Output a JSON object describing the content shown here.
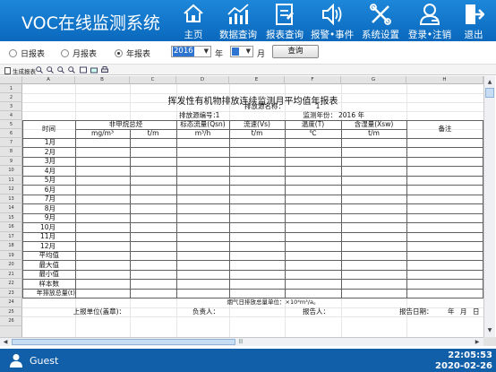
{
  "app": {
    "title": "VOC在线监测系统"
  },
  "nav": [
    {
      "label": "主页",
      "icon": "home-icon"
    },
    {
      "label": "数据查询",
      "icon": "chart-icon"
    },
    {
      "label": "报表查询",
      "icon": "report-icon"
    },
    {
      "label": "报警•事件",
      "icon": "speaker-icon"
    },
    {
      "label": "系统设置",
      "icon": "tools-icon"
    },
    {
      "label": "登录•注销",
      "icon": "user-icon"
    },
    {
      "label": "退出",
      "icon": "exit-icon"
    }
  ],
  "filter": {
    "daily": "日报表",
    "monthly": "月报表",
    "yearly": "年报表",
    "selected": "年报表",
    "year_value": "2016",
    "year_unit": "年",
    "month_value": "",
    "month_unit": "月",
    "query_label": "查询"
  },
  "report_toolbar": {
    "generate_label": "生成报表",
    "icons": [
      "zoom-in-icon",
      "zoom-out-icon",
      "zoom-out-icon",
      "zoom-fit-icon",
      "view-icon",
      "export-icon",
      "print-icon"
    ]
  },
  "sheet": {
    "columns": [
      "A",
      "B",
      "C",
      "D",
      "E",
      "F",
      "G",
      "H"
    ],
    "rows": [
      "1",
      "2",
      "3",
      "4",
      "5",
      "6",
      "7",
      "8",
      "9",
      "10",
      "11",
      "12",
      "13",
      "14",
      "15",
      "16",
      "17",
      "18",
      "19",
      "20",
      "21",
      "22",
      "23",
      "24",
      "25",
      "26"
    ],
    "title": "挥发性有机物排放连续监测月平均值年报表",
    "source_name_label": "排放源名称：",
    "source_name_value": "1",
    "source_no_label": "排放源编号：",
    "source_no_value": "1",
    "year_label": "监测年份：",
    "year_value": "2016 年",
    "headers": {
      "time": "时间",
      "nmhc": "非甲烷总烃",
      "flow": "标态流量(Qsn)",
      "velocity": "流速(Vs)",
      "temp": "温度(T)",
      "moisture": "含湿量(Xsw)",
      "remark": "备注"
    },
    "units": {
      "conc": "mg/m³",
      "rate": "t/m",
      "flow": "m³/h",
      "velocity": "t/m",
      "temp": "℃",
      "moisture": "t/m"
    },
    "months": [
      "1月",
      "2月",
      "3月",
      "4月",
      "5月",
      "6月",
      "7月",
      "8月",
      "9月",
      "10月",
      "11月",
      "12月"
    ],
    "stats": [
      "平均值",
      "最大值",
      "最小值",
      "样本数"
    ],
    "total_label": "年排放总量(t)",
    "smoke_note": "烟气日排放总量单位：×10⁴m³/a。",
    "footer": {
      "unit": "上报单位(盖章)：",
      "manager": "负责人：",
      "reporter": "报告人：",
      "date_label": "报告日期：",
      "year": "年",
      "month": "月",
      "day": "日"
    }
  },
  "status": {
    "user": "Guest",
    "time": "22:05:53",
    "date": "2020-02-26"
  }
}
